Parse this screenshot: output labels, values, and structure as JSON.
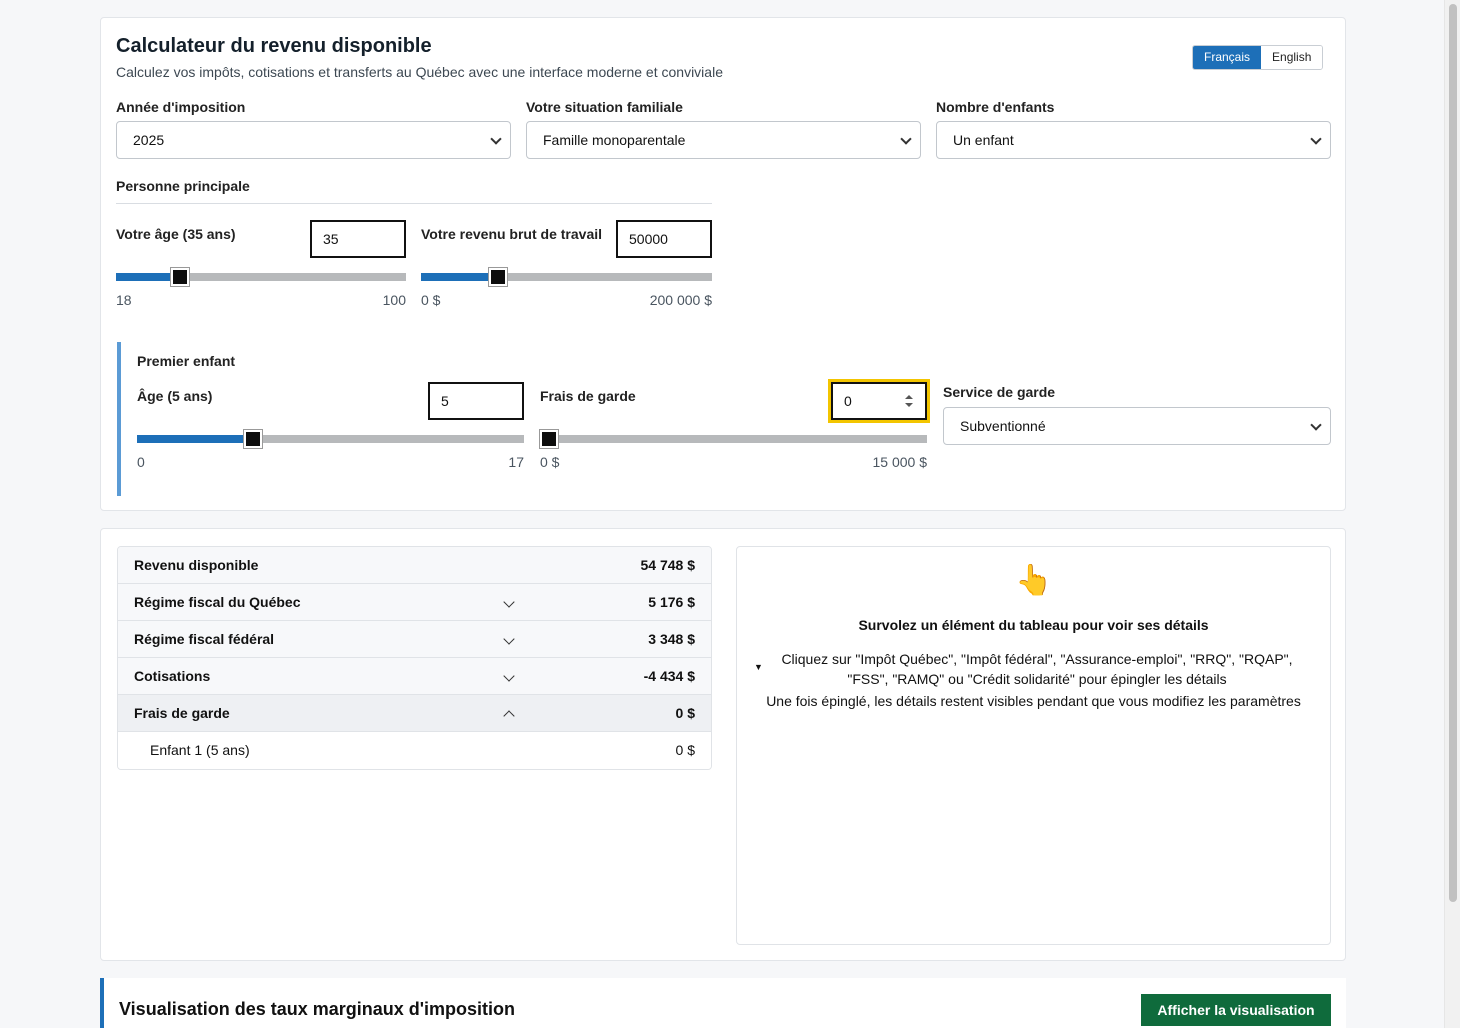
{
  "header": {
    "title": "Calculateur du revenu disponible",
    "subtitle": "Calculez vos impôts, cotisations et transferts au Québec avec une interface moderne et conviviale",
    "languages": [
      "Français",
      "English"
    ]
  },
  "filters": {
    "tax_year": {
      "label": "Année d'imposition",
      "value": "2025"
    },
    "family": {
      "label": "Votre situation familiale",
      "value": "Famille monoparentale"
    },
    "children": {
      "label": "Nombre d'enfants",
      "value": "Un enfant"
    }
  },
  "principal": {
    "section": "Personne principale",
    "age": {
      "label": "Votre âge (35 ans)",
      "value": "35",
      "min_label": "18",
      "max_label": "100",
      "fraction": 0.22
    },
    "income": {
      "label": "Votre revenu brut de travail",
      "value": "50000",
      "min_label": "0 $",
      "max_label": "200 000 $",
      "fraction": 0.265
    }
  },
  "child": {
    "title": "Premier enfant",
    "age": {
      "label": "Âge (5 ans)",
      "value": "5",
      "min_label": "0",
      "max_label": "17",
      "fraction": 0.3
    },
    "fees": {
      "label": "Frais de garde",
      "value": "0",
      "min_label": "0 $",
      "max_label": "15 000 $",
      "fraction": 0
    },
    "service": {
      "label": "Service de garde",
      "value": "Subventionné"
    }
  },
  "results": {
    "rows": [
      {
        "label": "Revenu disponible",
        "value": "54 748 $"
      },
      {
        "label": "Régime fiscal du Québec",
        "value": "5 176 $"
      },
      {
        "label": "Régime fiscal fédéral",
        "value": "3 348 $"
      },
      {
        "label": "Cotisations",
        "value": "-4 434 $"
      },
      {
        "label": "Frais de garde",
        "value": "0 $"
      },
      {
        "label": "Enfant 1 (5 ans)",
        "value": "0 $"
      }
    ]
  },
  "details": {
    "icon": "👆",
    "title": "Survolez un élément du tableau pour voir ses détails",
    "instructions": "Cliquez sur \"Impôt Québec\", \"Impôt fédéral\", \"Assurance-emploi\", \"RRQ\", \"RQAP\", \"FSS\", \"RAMQ\" ou \"Crédit solidarité\" pour épingler les détails",
    "note": "Une fois épinglé, les détails restent visibles pendant que vous modifiez les paramètres"
  },
  "visualization": {
    "title": "Visualisation des taux marginaux d'imposition",
    "button": "Afficher la visualisation"
  },
  "colors": {
    "accent": "#1d6fb8",
    "button_green": "#0f6b3c",
    "focus": "#f3c500",
    "child_border": "#5b9bd5"
  }
}
